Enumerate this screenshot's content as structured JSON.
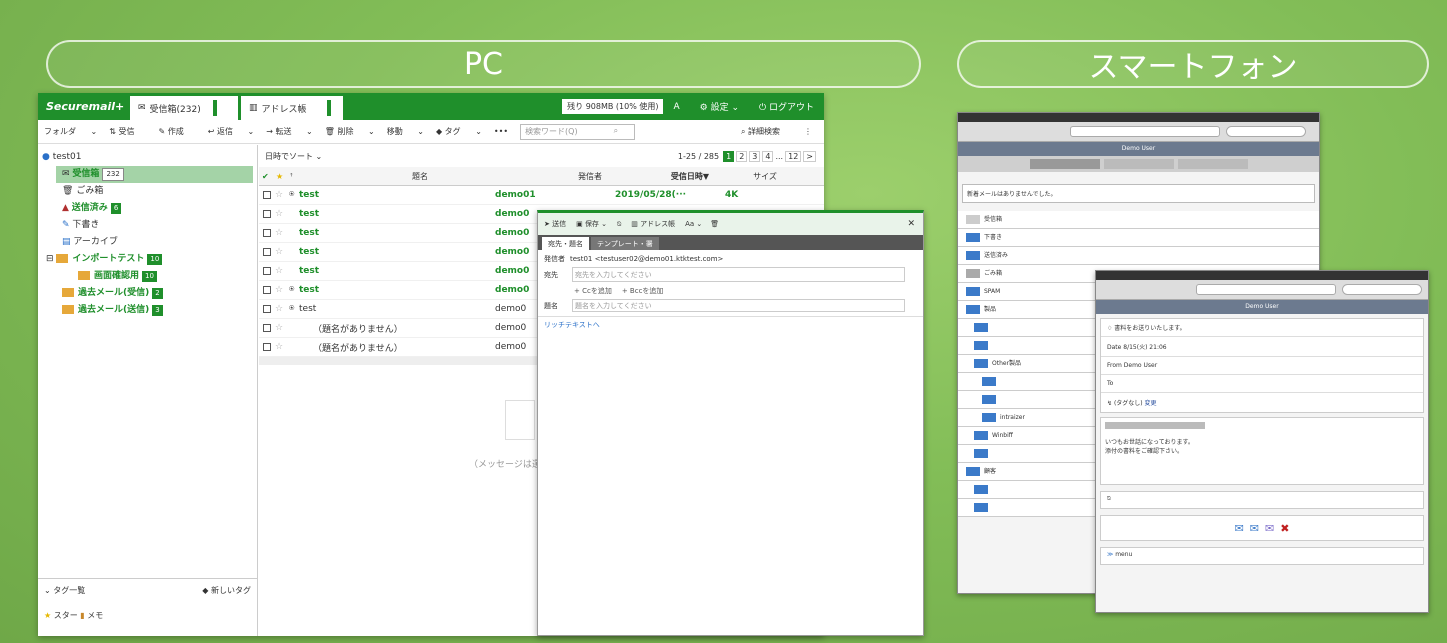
{
  "headers": {
    "pc": "PC",
    "phone": "スマートフォン"
  },
  "pc": {
    "logo": "Securemail+",
    "tabs": [
      {
        "label": "受信箱(232)"
      },
      {
        "label": "アドレス帳"
      }
    ],
    "quota": "残り 908MB (10% 使用)",
    "settings": "設定",
    "logout": "ログアウト",
    "toolbar": {
      "folder": "フォルダ",
      "receive": "受信",
      "compose": "作成",
      "reply": "返信",
      "forward": "転送",
      "delete": "削除",
      "move": "移動",
      "tag": "タグ",
      "more": "•••",
      "search_placeholder": "検索ワード(Q)",
      "advanced": "詳細検索"
    },
    "account": "test01",
    "folders": [
      {
        "label": "受信箱",
        "count": "232"
      },
      {
        "label": "ごみ箱",
        "count": ""
      },
      {
        "label": "送信済み",
        "count": "6"
      },
      {
        "label": "下書き",
        "count": ""
      },
      {
        "label": "アーカイブ",
        "count": ""
      },
      {
        "label": "インポートテスト",
        "count": "10"
      },
      {
        "label": "画面確認用",
        "count": "10"
      },
      {
        "label": "過去メール(受信)",
        "count": "2"
      },
      {
        "label": "過去メール(送信)",
        "count": "3"
      }
    ],
    "tags_header": "タグ一覧",
    "new_tag": "新しいタグ",
    "tags": [
      "スター",
      "メモ"
    ],
    "sort": "日時でソート",
    "pagination": {
      "range": "1-25 / 285",
      "pages": [
        "1",
        "2",
        "3",
        "4",
        "...",
        "12",
        ">"
      ]
    },
    "columns": [
      "題名",
      "発信者",
      "受信日時▼",
      "サイズ"
    ],
    "rows": [
      {
        "subject": "test",
        "sender": "demo01",
        "date": "2019/05/28(···",
        "size": "4K"
      },
      {
        "subject": "test",
        "sender": "demo0",
        "date": "",
        "size": ""
      },
      {
        "subject": "test",
        "sender": "demo0",
        "date": "",
        "size": ""
      },
      {
        "subject": "test",
        "sender": "demo0",
        "date": "",
        "size": ""
      },
      {
        "subject": "test",
        "sender": "demo0",
        "date": "",
        "size": ""
      },
      {
        "subject": "test",
        "sender": "demo0",
        "date": "",
        "size": ""
      },
      {
        "subject": "test",
        "sender": "demo0",
        "date": "",
        "size": ""
      },
      {
        "subject": "（題名がありません）",
        "sender": "demo0",
        "date": "",
        "size": ""
      },
      {
        "subject": "（題名がありません）",
        "sender": "demo0",
        "date": "",
        "size": ""
      }
    ],
    "empty_message": "（メッセージは選"
  },
  "compose": {
    "toolbar": {
      "send": "送信",
      "save": "保存",
      "addressbook": "アドレス帳",
      "font": "Aa"
    },
    "tabs": [
      "宛先・題名",
      "テンプレート・署"
    ],
    "from_label": "発信者",
    "from_value": "test01 <testuser02@demo01.ktktest.com>",
    "to_label": "宛先",
    "to_placeholder": "宛先を入力してください",
    "cc": "+ Ccを追加",
    "bcc": "+ Bccを追加",
    "subject_label": "題名",
    "subject_placeholder": "題名を入力してください",
    "richtext": "リッチテキストへ"
  },
  "phone1": {
    "nav_title": "Demo User",
    "notice": "新着メールはありませんでした。",
    "items": [
      "受信箱",
      "下書き",
      "送信済み",
      "ごみ箱",
      "SPAM",
      "製品",
      "",
      "",
      "Other製品",
      "",
      "",
      "intraizer",
      "Winbiff",
      "",
      "顧客",
      "",
      ""
    ]
  },
  "phone2": {
    "nav_title": "Demo User",
    "subject": "♢ 書料をお送りいたします。",
    "date": "Date  8/15(火) 21:06",
    "from": "From  Demo User",
    "to": "To",
    "tag": "(タグなし)",
    "tag_change": "変更",
    "body": [
      "いつもお世話になっております。",
      "添付の書料をご確認下さい。"
    ],
    "menu": "menu"
  }
}
